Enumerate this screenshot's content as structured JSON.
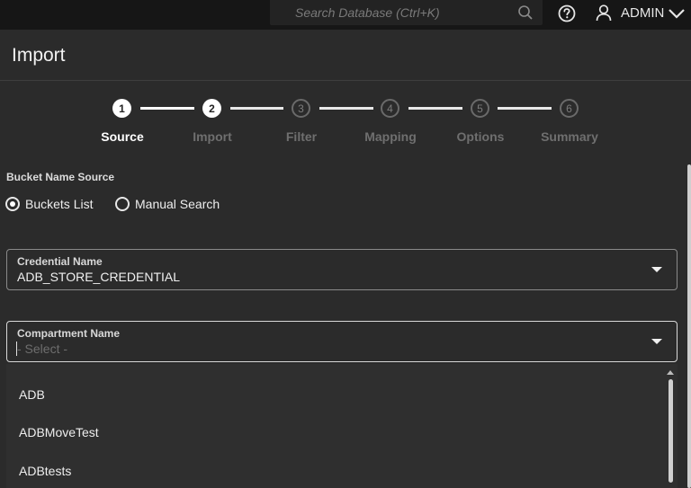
{
  "topbar": {
    "search_placeholder": "Search Database (Ctrl+K)",
    "user_name": "ADMIN"
  },
  "page": {
    "title": "Import"
  },
  "steps": [
    {
      "number": "1",
      "label": "Source",
      "state": "active"
    },
    {
      "number": "2",
      "label": "Import",
      "state": "todo"
    },
    {
      "number": "3",
      "label": "Filter",
      "state": "todo"
    },
    {
      "number": "4",
      "label": "Mapping",
      "state": "todo"
    },
    {
      "number": "5",
      "label": "Options",
      "state": "todo"
    },
    {
      "number": "6",
      "label": "Summary",
      "state": "todo"
    }
  ],
  "bucket_source": {
    "label": "Bucket Name Source",
    "options": [
      {
        "label": "Buckets List",
        "checked": true
      },
      {
        "label": "Manual Search",
        "checked": false
      }
    ]
  },
  "credential": {
    "label": "Credential Name",
    "value": "ADB_STORE_CREDENTIAL"
  },
  "compartment": {
    "label": "Compartment Name",
    "placeholder": "- Select -",
    "options": [
      "ADB",
      "ADBMoveTest",
      "ADBtests"
    ]
  },
  "colors": {
    "background": "#2b2b2b",
    "topbar": "#161616",
    "text": "#f0f0f0",
    "muted": "#6f6f6f"
  }
}
